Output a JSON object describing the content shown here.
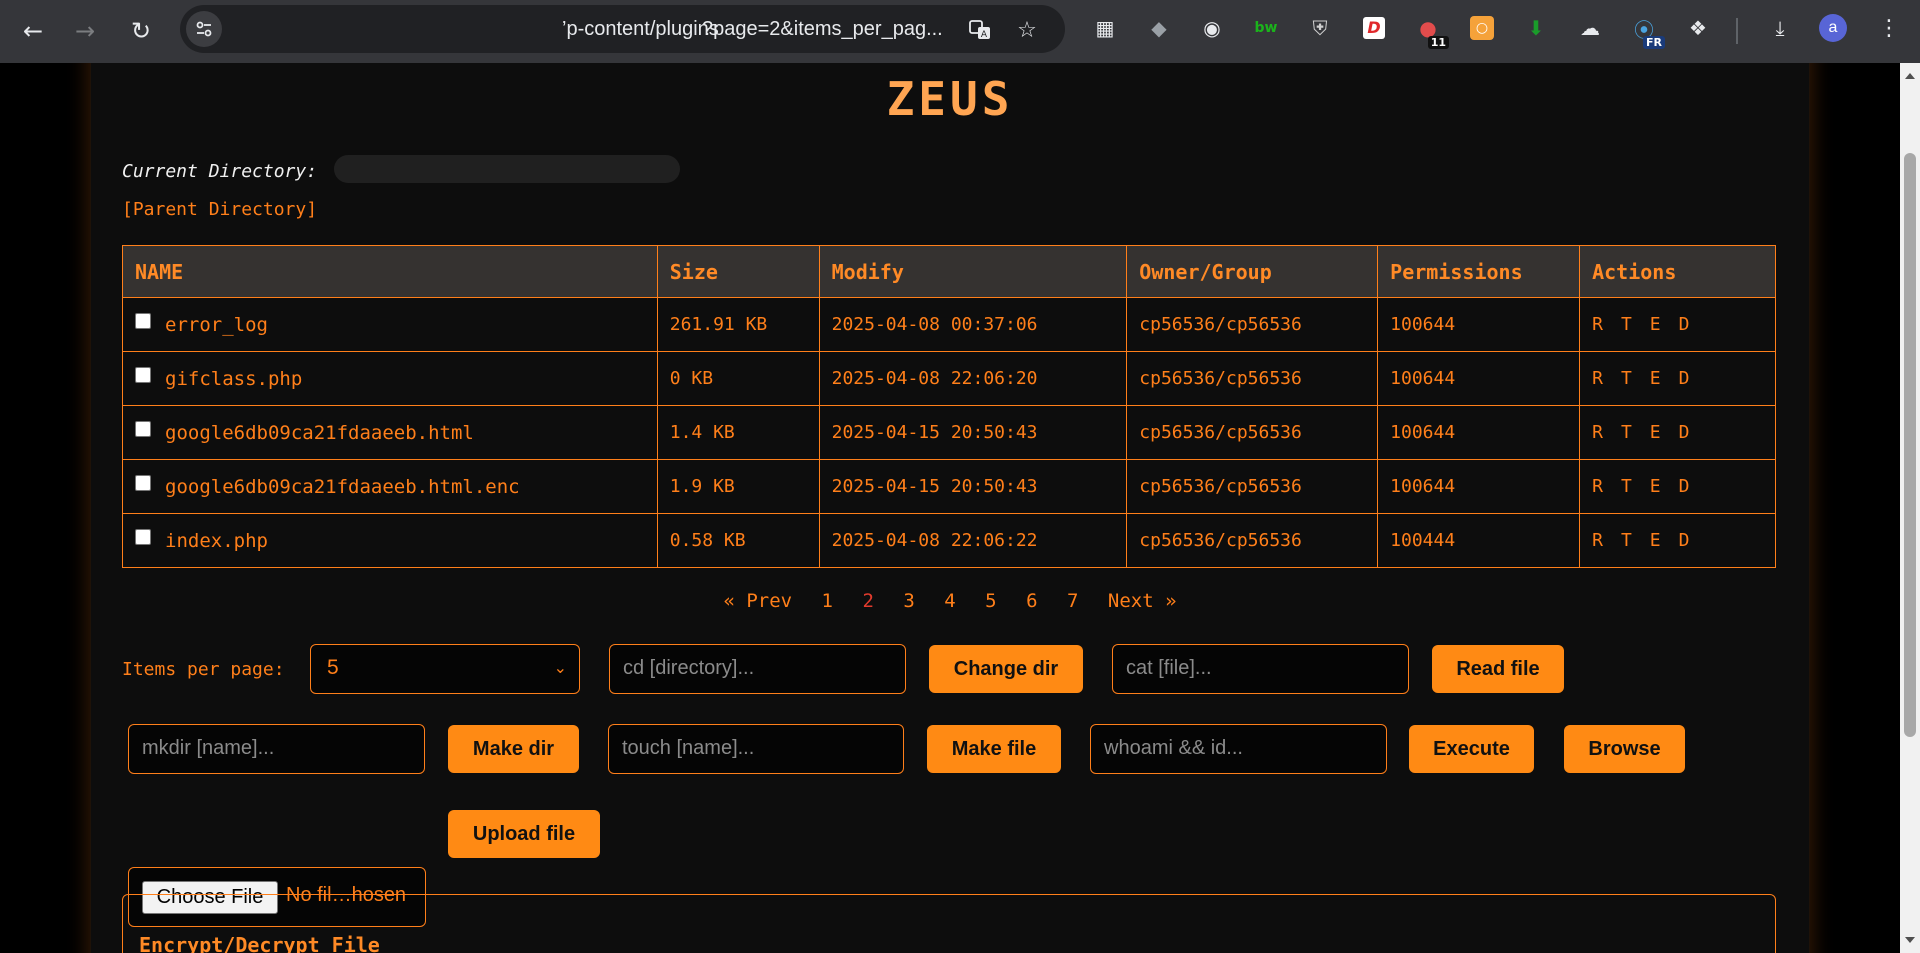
{
  "browser": {
    "url_part_1": "’p-content/plugins",
    "url_part_2": "?page=2&items_per_pag...",
    "profile_initial": "a",
    "extensions": [
      {
        "icon": "qr-code-icon",
        "glyph": "▦"
      },
      {
        "icon": "wolf-icon",
        "glyph": "◆"
      },
      {
        "icon": "robot-icon",
        "glyph": "◉"
      },
      {
        "icon": "builtwith-icon",
        "glyph": "bw"
      },
      {
        "icon": "shield-icon",
        "glyph": "⛨"
      },
      {
        "icon": "d-extension-icon",
        "glyph": "D"
      },
      {
        "icon": "notification-extension-icon",
        "glyph": "●",
        "badge": "11"
      },
      {
        "icon": "box-extension-icon",
        "glyph": "▣"
      },
      {
        "icon": "download-arrow-icon",
        "glyph": "⬇"
      },
      {
        "icon": "cloud-icon",
        "glyph": "☁"
      },
      {
        "icon": "translate-globe-icon",
        "glyph": "⦿",
        "badge": "FR"
      },
      {
        "icon": "puzzle-icon",
        "glyph": "❖"
      }
    ]
  },
  "page": {
    "title": "ZEUS",
    "current_dir_label": "Current Directory:",
    "parent_link": "[Parent Directory]"
  },
  "table": {
    "headers": [
      "NAME",
      "Size",
      "Modify",
      "Owner/Group",
      "Permissions",
      "Actions"
    ],
    "rows": [
      {
        "name": "error_log",
        "size": "261.91 KB",
        "modify": "2025-04-08 00:37:06",
        "owner": "cp56536/cp56536",
        "perms": "100644"
      },
      {
        "name": "gifclass.php",
        "size": "0 KB",
        "modify": "2025-04-08 22:06:20",
        "owner": "cp56536/cp56536",
        "perms": "100644"
      },
      {
        "name": "google6db09ca21fdaaeeb.html",
        "size": "1.4 KB",
        "modify": "2025-04-15 20:50:43",
        "owner": "cp56536/cp56536",
        "perms": "100644"
      },
      {
        "name": "google6db09ca21fdaaeeb.html.enc",
        "size": "1.9 KB",
        "modify": "2025-04-15 20:50:43",
        "owner": "cp56536/cp56536",
        "perms": "100644"
      },
      {
        "name": "index.php",
        "size": "0.58 KB",
        "modify": "2025-04-08 22:06:22",
        "owner": "cp56536/cp56536",
        "perms": "100444"
      }
    ],
    "actions": [
      "R",
      "T",
      "E",
      "D"
    ]
  },
  "pager": {
    "prev": "« Prev",
    "pages": [
      "1",
      "2",
      "3",
      "4",
      "5",
      "6",
      "7"
    ],
    "current": "2",
    "next": "Next »"
  },
  "controls": {
    "items_per_page_label": "Items per page:",
    "items_per_page_value": "5",
    "cd_placeholder": "cd [directory]...",
    "change_dir": "Change dir",
    "cat_placeholder": "cat [file]...",
    "read_file": "Read file",
    "mkdir_placeholder": "mkdir [name]...",
    "make_dir": "Make dir",
    "touch_placeholder": "touch [name]...",
    "make_file": "Make file",
    "cmd_placeholder": "whoami && id...",
    "execute": "Execute",
    "browse": "Browse",
    "choose_file": "Choose File",
    "no_file": "No fil…hosen",
    "upload_file": "Upload file"
  },
  "encrypt": {
    "title": "Encrypt/Decrypt File"
  },
  "colors": {
    "accent": "#ff7f1a",
    "button": "#ff8a14",
    "current_page": "#e23b2d",
    "title": "#ffa552",
    "background": "#0d0d0d"
  }
}
